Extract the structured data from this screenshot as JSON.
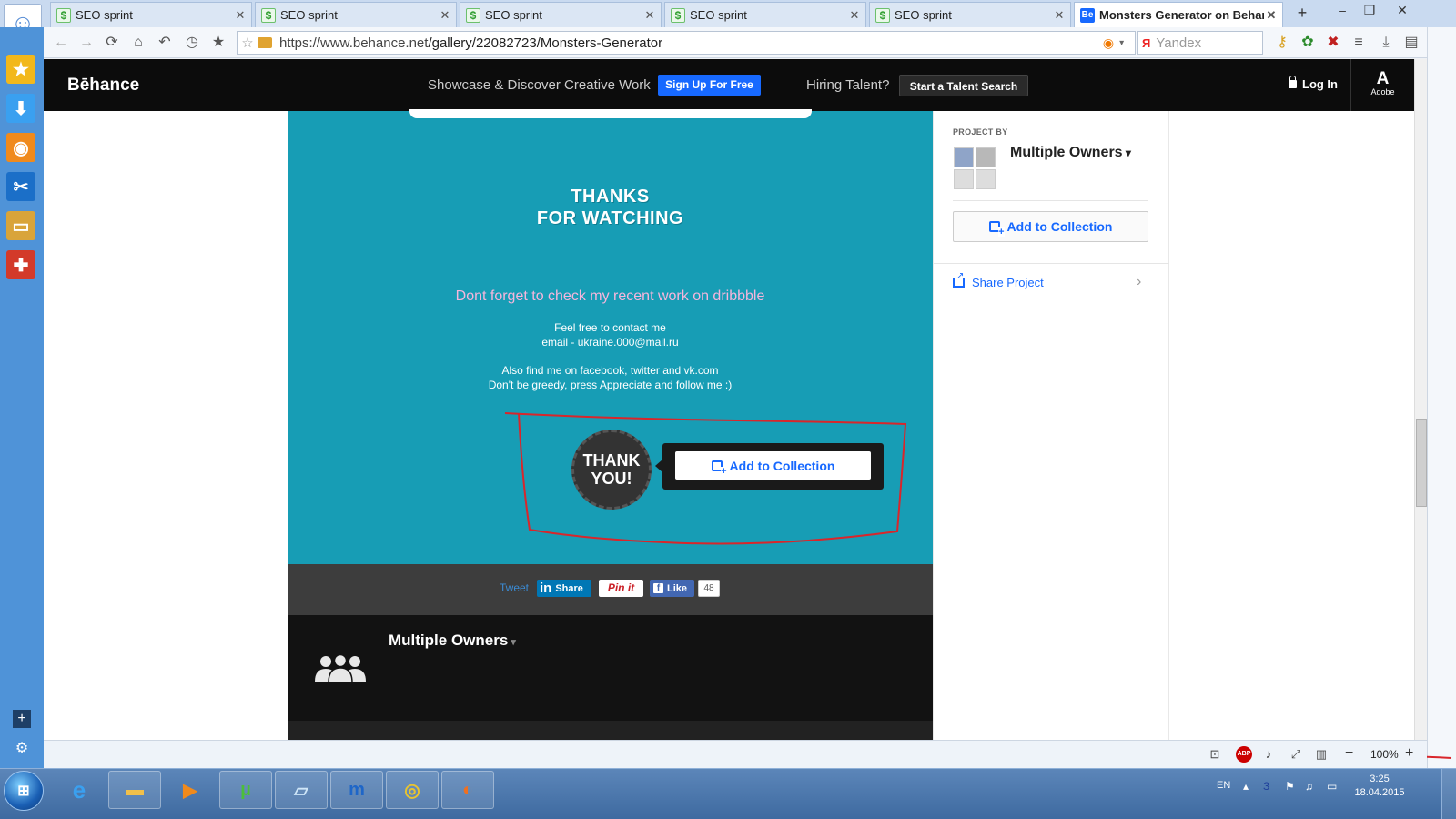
{
  "tabs": [
    {
      "label": "SEO sprint",
      "favicon": "seo-sprint-icon"
    },
    {
      "label": "SEO sprint",
      "favicon": "seo-sprint-icon"
    },
    {
      "label": "SEO sprint",
      "favicon": "seo-sprint-icon"
    },
    {
      "label": "SEO sprint",
      "favicon": "seo-sprint-icon"
    },
    {
      "label": "SEO sprint",
      "favicon": "seo-sprint-icon"
    },
    {
      "label": "Monsters Generator on Behance",
      "favicon": "behance-icon",
      "active": true
    }
  ],
  "tab_favicon_text": {
    "seo": "$",
    "behance": "Be"
  },
  "address": {
    "url_host": "https://www.behance.net",
    "url_path": "/gallery/22082723/Monsters-Generator",
    "search_engine": "Yandex",
    "search_engine_mark": "Я"
  },
  "behance": {
    "logo": "Bēhance",
    "tagline": "Showcase & Discover Creative Work",
    "signup": "Sign Up For Free",
    "hiring": "Hiring Talent?",
    "talent_search": "Start a Talent Search",
    "login": "Log In",
    "adobe_mark": "A",
    "adobe": "Adobe"
  },
  "project": {
    "thanks_line1": "THANKS",
    "thanks_line2": "FOR WATCHING",
    "dribbble_note": "Dont forget to check my recent work on dribbble",
    "contact_line1": "Feel free to contact me",
    "contact_line2": "email - ukraine.000@mail.ru",
    "social_line1": "Also find me on facebook, twitter and vk.com",
    "social_line2": "Don't be greedy, press Appreciate and follow me :)",
    "badge_line1": "THANK",
    "badge_line2": "YOU!",
    "add_to_collection": "Add to Collection"
  },
  "social": {
    "tweet": "Tweet",
    "linkedin_mark": "in",
    "linkedin": "Share",
    "pinit": "Pin it",
    "facebook_mark": "f",
    "facebook": "Like",
    "facebook_count": "48"
  },
  "owners": {
    "title": "Multiple Owners"
  },
  "sidebar": {
    "project_by": "PROJECT BY",
    "owner": "Multiple Owners",
    "add_to_collection": "Add to Collection",
    "share_project": "Share Project"
  },
  "status": {
    "abp": "ABP",
    "zoom": "100%"
  },
  "taskbar": {
    "lang": "EN",
    "date": "18.04.2015",
    "time": "3:25"
  },
  "colors": {
    "behance_blue": "#1769ff",
    "project_bg": "#179db5",
    "annotation_red": "#d9262b"
  }
}
